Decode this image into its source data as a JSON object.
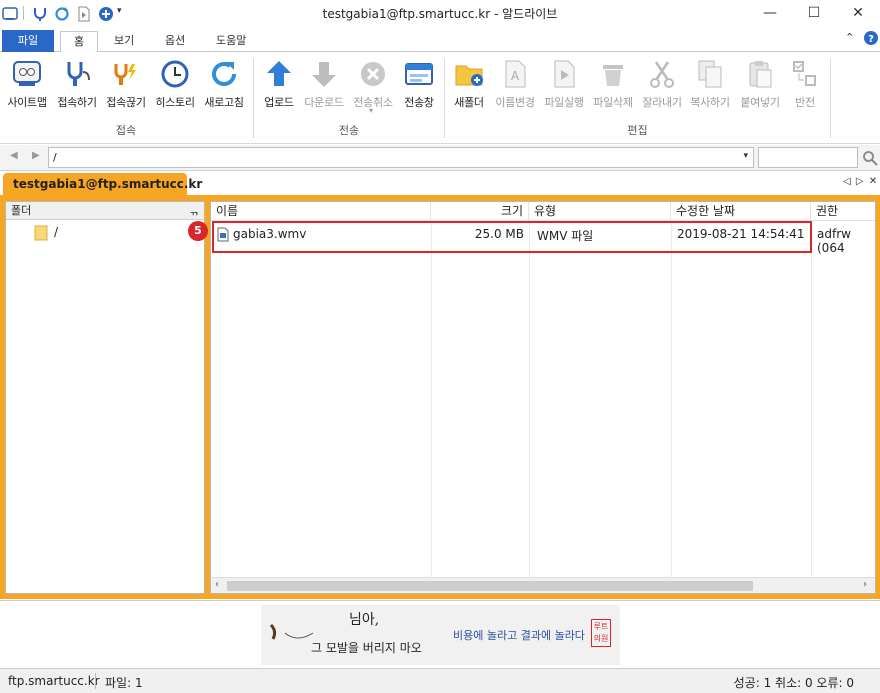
{
  "window": {
    "title": "testgabia1@ftp.smartucc.kr - 알드라이브",
    "controls": [
      "—",
      "☐",
      "✕"
    ]
  },
  "ribbon_tabs": [
    "파일",
    "홈",
    "보기",
    "옵션",
    "도움말"
  ],
  "ribbon_right_icons": [
    "chevron-up-icon",
    "help-icon"
  ],
  "ribbon": {
    "groups": [
      {
        "label": "접속",
        "buttons": [
          "사이트맵",
          "접속하기",
          "접속끊기",
          "히스토리",
          "새로고침"
        ]
      },
      {
        "label": "전송",
        "buttons": [
          "업로드",
          "다운로드",
          "전송취소",
          "전송창"
        ]
      },
      {
        "label": "편집",
        "buttons": [
          "새폴더",
          "이름변경",
          "파일실행",
          "파일삭제",
          "잘라내기",
          "복사하기",
          "붙여넣기",
          "반전"
        ]
      }
    ],
    "disabled": [
      "다운로드",
      "전송취소",
      "이름변경",
      "파일실행",
      "파일삭제",
      "잘라내기",
      "복사하기",
      "붙여넣기",
      "반전"
    ]
  },
  "address": {
    "path": "/",
    "search_placeholder": ""
  },
  "doc_tab": {
    "label": "testgabia1@ftp.smartucc.kr",
    "nav": "◁ ▷ ✕"
  },
  "folder_pane": {
    "header": "폴더",
    "pin": "ᆩ",
    "root": "/"
  },
  "file_list": {
    "columns": [
      "이름",
      "크기",
      "유형",
      "수정한 날짜",
      "권한"
    ],
    "rows": [
      {
        "name": "gabia3.wmv",
        "size": "25.0 MB",
        "type": "WMV 파일",
        "modified": "2019-08-21 14:54:41",
        "perm": "adfrw (064"
      }
    ],
    "marker": "5"
  },
  "banner": {
    "line1": "님아,",
    "line2": "그 모발을 버리지 마오",
    "line3": "비용에 놀라고 결과에 놀라다",
    "stamp": "루트의원"
  },
  "status": {
    "server": "ftp.smartucc.kr",
    "files": "파일: 1",
    "summary": "성공: 1 취소: 0 오류: 0"
  },
  "colors": {
    "accent": "#f6a623",
    "file_tab": "#2a68c8",
    "highlight": "#d9262c"
  }
}
